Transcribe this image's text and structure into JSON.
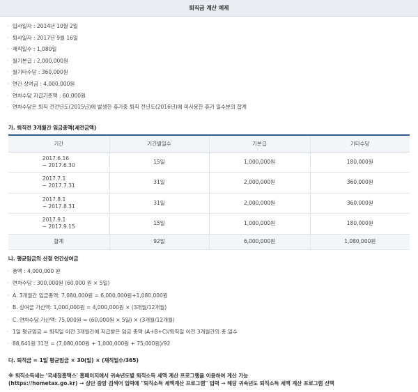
{
  "title": "퇴직금 계산 예제",
  "info": [
    "입사일자 : 2014년 10월 2일",
    "퇴사일자 : 2017년 9월 16일",
    "재직일수 : 1,080일",
    "월기본급 : 2,000,000원",
    "월기타수당 : 360,000원",
    "연간 상여금 : 4,000,000원",
    "연차수당 지급기준액 : 60,000원",
    "연차수당은 퇴직 전전년도(2015년)에 발생한 휴가중 퇴직 전년도(2016년)에 미사용한 휴가 일수분의 합계"
  ],
  "section_a_title": "가. 퇴직전 3개월간 임금총액(세전금액)",
  "table": {
    "headers": [
      "기간",
      "기간별일수",
      "기본급",
      "기타수당"
    ],
    "rows": [
      {
        "period_start": "2017.6.16",
        "period_end": "~ 2017.6.30",
        "days": "15일",
        "base": "1,000,000원",
        "other": "180,000원"
      },
      {
        "period_start": "2017.7.1",
        "period_end": "~ 2017.7.31",
        "days": "31일",
        "base": "2,000,000원",
        "other": "360,000원"
      },
      {
        "period_start": "2017.8.1",
        "period_end": "~ 2017.8.31",
        "days": "31일",
        "base": "2,000,000원",
        "other": "360,000원"
      },
      {
        "period_start": "2017.9.1",
        "period_end": "~ 2017.9.15",
        "days": "15일",
        "base": "1,000,000원",
        "other": "180,000원"
      }
    ],
    "total": {
      "label": "합계",
      "days": "92일",
      "base": "6,000,000원",
      "other": "1,080,000원"
    }
  },
  "section_b_title": "나. 평균임금의 산정 연간상여금",
  "avg_items": [
    "총액 : 4,000,000 원",
    "연차수당 : 300,000원 (60,000 원 × 5일)",
    "A. 3개월간 임금총액: 7,080,000원 = 6,000,000원+1,080,000원",
    "B. 상여금 가산액: 1,000,000원 = 4,000,000원 × (3개월/12개월)",
    "C. 연차수당 가산액: 75,000원 = (60,000원 × 5일) × (3개월/12개월)",
    "1일 평균임금 = 퇴직일 이전 3개월간에 지급받은 임금 총액 (A+B+C)/퇴직일 이전 3개월간의 총 일수",
    "88,641원 31전 = (7,080,000원 + 1,000,000원 + 75,000원)/92"
  ],
  "section_c_title": "다. 퇴직금 = 1일 평균임금 × 30(일) × (재직일수/365)",
  "note_line1": "※ 퇴직소득세는 '국세청홈택스' 홈페이지에서 귀속년도별 퇴직소득 세액 계산 프로그램을 이용하여 계산 가능",
  "note_line2": "(https://hometax.go.kr) → 상단 중앙 검색어 입력에 \"퇴직소득 세액계산 프로그램\" 입력 → 해당 귀속년도 퇴직소득 세액 계산 프로그램 선택"
}
